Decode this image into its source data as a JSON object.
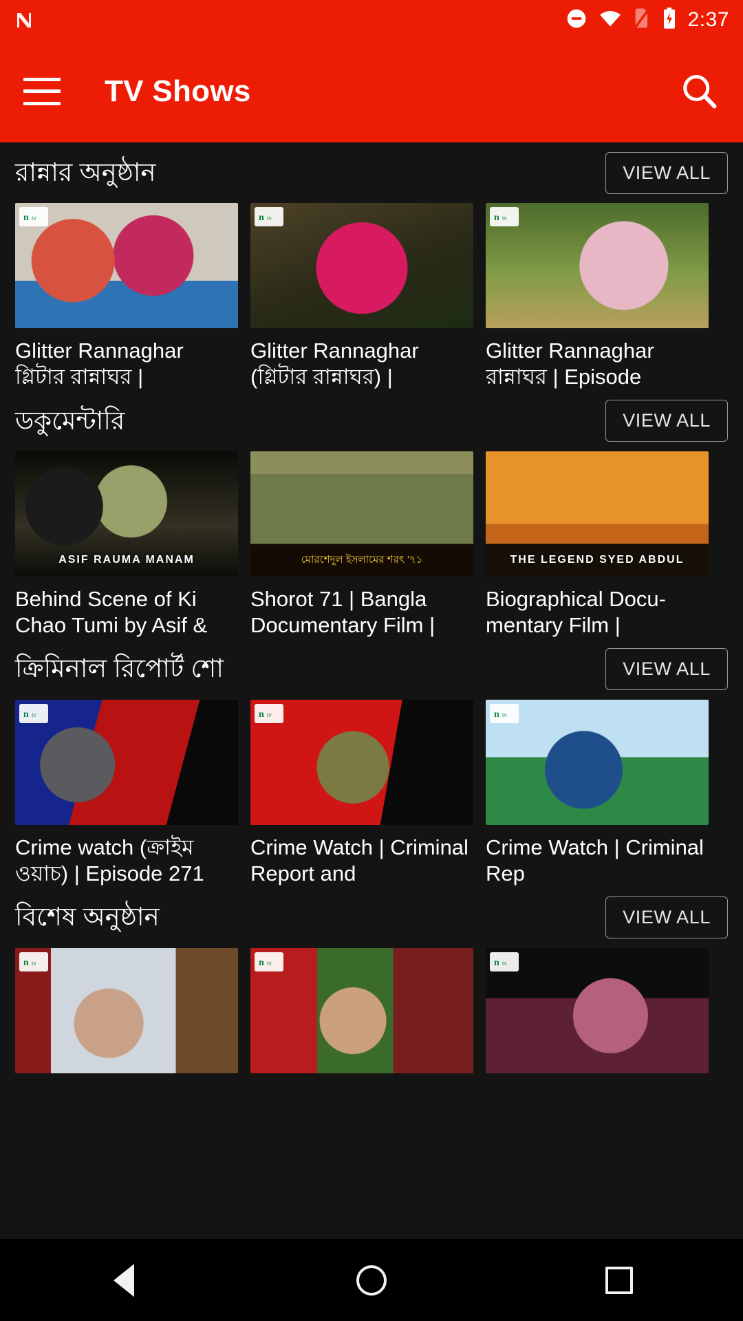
{
  "status_bar": {
    "time": "2:37",
    "icons": [
      "n-logo-icon",
      "do-not-disturb-icon",
      "wifi-icon",
      "no-sim-icon",
      "battery-charging-icon"
    ]
  },
  "app_bar": {
    "menu_icon": "hamburger-menu-icon",
    "title": "TV Shows",
    "search_icon": "search-icon"
  },
  "colors": {
    "brand_red": "#ED1C05",
    "background": "#141414",
    "text_primary": "#FFFFFF",
    "nav_bar": "#000000"
  },
  "sections": [
    {
      "title": "রান্নার অনুষ্ঠান",
      "view_all_label": "VIEW ALL",
      "cards": [
        {
          "title": "Glitter Rannaghar গ্লিটার রান্নাঘর  |",
          "thumb_class": "t-cook1",
          "badge": "ntv-logo-icon",
          "overlay": "",
          "band": ""
        },
        {
          "title": "Glitter Rannaghar (গ্লিটার রান্নাঘর) |",
          "thumb_class": "t-cook2",
          "badge": "ntv-logo-icon",
          "overlay": "",
          "band": ""
        },
        {
          "title": "Glitter Rannaghar রান্নাঘর  | Episode",
          "thumb_class": "t-cook3",
          "badge": "ntv-logo-icon",
          "overlay": "",
          "band": ""
        }
      ]
    },
    {
      "title": "ডকুমেন্টারি",
      "view_all_label": "VIEW ALL",
      "cards": [
        {
          "title": "Behind Scene of Ki Chao Tumi by Asif &",
          "thumb_class": "t-doc1",
          "badge": "",
          "overlay": "ASIF    RAUMA    MANAM",
          "band": ""
        },
        {
          "title": "Shorot 71 | Bangla Documentary Film |",
          "thumb_class": "t-doc2",
          "badge": "",
          "overlay": "",
          "band": "মোরশেদুল ইসলামের   শরৎ '৭১"
        },
        {
          "title": "Biographical Docu­mentary Film |",
          "thumb_class": "t-doc3",
          "badge": "",
          "overlay": "THE LEGEND  SYED ABDUL",
          "band": ""
        }
      ]
    },
    {
      "title": "ক্রিমিনাল রিপোর্ট শো",
      "view_all_label": "VIEW ALL",
      "cards": [
        {
          "title": "Crime watch (ক্রাইম ওয়াচ) | Episode 271",
          "thumb_class": "t-cw1",
          "badge": "ntv-logo-icon",
          "overlay": "",
          "band": ""
        },
        {
          "title": "Crime Watch | Criminal Report and",
          "thumb_class": "t-cw2",
          "badge": "ntv-logo-icon",
          "overlay": "",
          "band": ""
        },
        {
          "title": "Crime Watch | Criminal Rep",
          "thumb_class": "t-cw3",
          "badge": "ntv-logo-icon",
          "overlay": "",
          "band": ""
        }
      ]
    },
    {
      "title": "বিশেষ অনুষ্ঠান",
      "view_all_label": "VIEW ALL",
      "cards": [
        {
          "title": "",
          "thumb_class": "t-sp1",
          "badge": "ntv-logo-icon",
          "overlay": "",
          "band": ""
        },
        {
          "title": "",
          "thumb_class": "t-sp2",
          "badge": "ntv-logo-icon",
          "overlay": "",
          "band": ""
        },
        {
          "title": "",
          "thumb_class": "t-sp3",
          "badge": "ntv-logo-icon",
          "overlay": "",
          "band": ""
        }
      ]
    }
  ],
  "nav_bar": {
    "back_label": "back-button",
    "home_label": "home-button",
    "recents_label": "recents-button"
  }
}
